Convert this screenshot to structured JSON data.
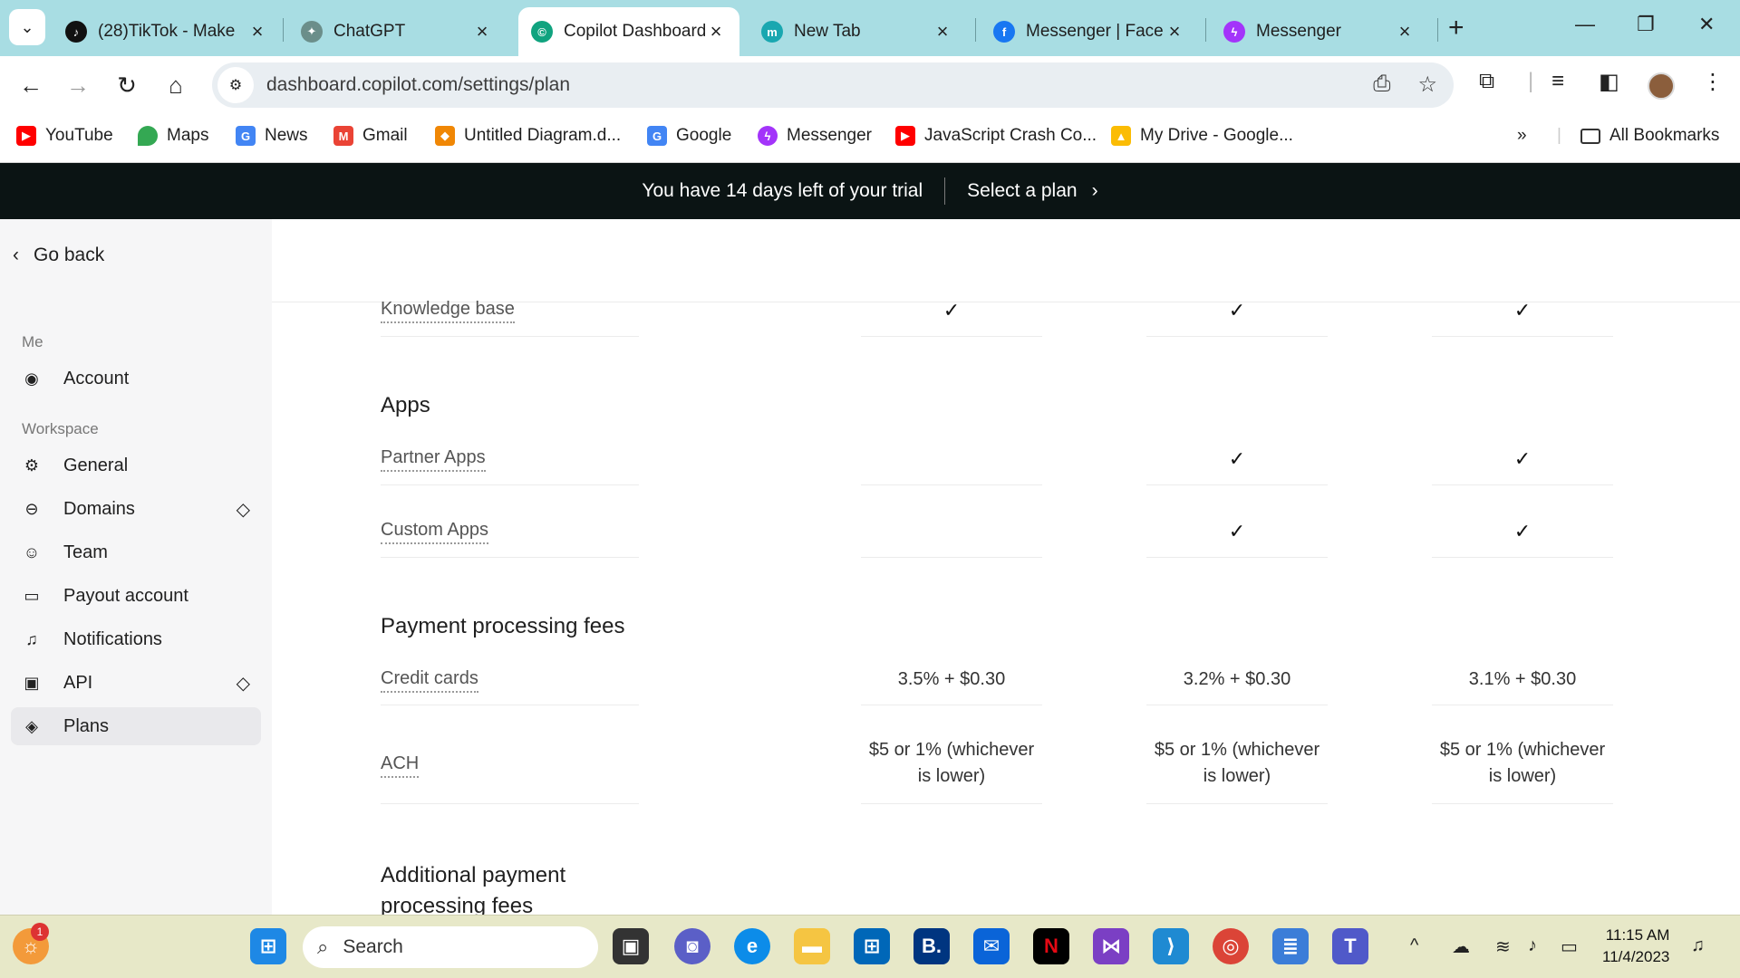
{
  "browser": {
    "tabs": [
      {
        "title": "(28)TikTok - Make",
        "favicon": "tiktok-icon",
        "color": "#111111"
      },
      {
        "title": "ChatGPT",
        "favicon": "chatgpt-icon",
        "color": "#6b8e8a"
      },
      {
        "title": "Copilot Dashboard",
        "favicon": "copilot-icon",
        "color": "#10a37f"
      },
      {
        "title": "New Tab",
        "favicon": "m-icon",
        "color": "#19a7b0"
      },
      {
        "title": "Messenger | Faceb",
        "favicon": "facebook-icon",
        "color": "#1877f2"
      },
      {
        "title": "Messenger",
        "favicon": "messenger-icon",
        "color": "#a334fa"
      }
    ],
    "url": "dashboard.copilot.com/settings/plan",
    "bookmarks": [
      {
        "label": "YouTube",
        "color": "#ff0000"
      },
      {
        "label": "Maps",
        "color": "#34a853"
      },
      {
        "label": "News",
        "color": "#4285f4"
      },
      {
        "label": "Gmail",
        "color": "#ea4335"
      },
      {
        "label": "Untitled Diagram.d...",
        "color": "#f08705"
      },
      {
        "label": "Google",
        "color": "#4285f4"
      },
      {
        "label": "Messenger",
        "color": "#a334fa"
      },
      {
        "label": "JavaScript Crash Co...",
        "color": "#ff0000"
      },
      {
        "label": "My Drive - Google...",
        "color": "#fbbc04"
      }
    ],
    "all_bookmarks": "All Bookmarks"
  },
  "banner": {
    "message": "You have 14 days left of your trial",
    "cta": "Select a plan"
  },
  "sidebar": {
    "go_back": "Go back",
    "sections": [
      {
        "heading": "Me",
        "items": [
          {
            "label": "Account",
            "icon": "account-icon"
          }
        ]
      },
      {
        "heading": "Workspace",
        "items": [
          {
            "label": "General",
            "icon": "gear-icon"
          },
          {
            "label": "Domains",
            "icon": "link-icon",
            "premium": true
          },
          {
            "label": "Team",
            "icon": "team-icon"
          },
          {
            "label": "Payout account",
            "icon": "card-icon"
          },
          {
            "label": "Notifications",
            "icon": "bell-icon"
          },
          {
            "label": "API",
            "icon": "api-icon",
            "premium": true
          },
          {
            "label": "Plans",
            "icon": "tag-icon",
            "active": true
          }
        ]
      }
    ]
  },
  "plans_table": {
    "rows": [
      {
        "feature": "Knowledge base",
        "values": [
          "✓",
          "✓",
          "✓"
        ]
      }
    ],
    "sections": [
      {
        "title": "Apps",
        "rows": [
          {
            "feature": "Partner Apps",
            "values": [
              "",
              "✓",
              "✓"
            ]
          },
          {
            "feature": "Custom Apps",
            "values": [
              "",
              "✓",
              "✓"
            ]
          }
        ]
      },
      {
        "title": "Payment processing fees",
        "rows": [
          {
            "feature": "Credit cards",
            "values": [
              "3.5% + $0.30",
              "3.2% + $0.30",
              "3.1% + $0.30"
            ]
          },
          {
            "feature": "ACH",
            "values": [
              "$5 or 1% (whichever is lower)",
              "$5 or 1% (whichever is lower)",
              "$5 or 1% (whichever is lower)"
            ]
          }
        ]
      },
      {
        "title": "Additional payment processing fees",
        "rows": []
      }
    ]
  },
  "taskbar": {
    "search_placeholder": "Search",
    "notification_count": "1",
    "time": "11:15 AM",
    "date": "11/4/2023"
  }
}
